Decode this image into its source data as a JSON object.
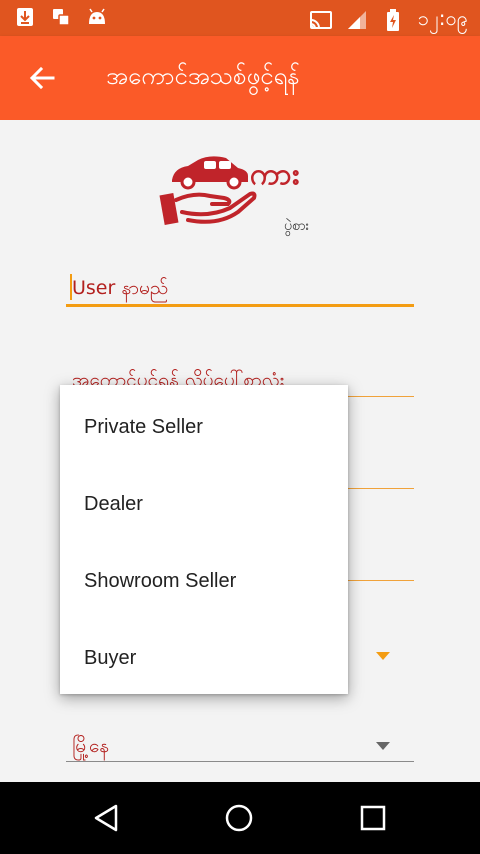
{
  "status_bar": {
    "time": "၁၂:၀၉",
    "left_icons": [
      "download-icon",
      "sim-icon",
      "android-icon"
    ],
    "right_icons": [
      "cast-icon",
      "signal-icon",
      "battery-charging-icon"
    ]
  },
  "app_bar": {
    "title": "အကောင်အသစ်ဖွင့်ရန်",
    "back_icon": "back-arrow-icon"
  },
  "logo": {
    "brand": "ကား",
    "sub": "ပွဲစား"
  },
  "form": {
    "username_label": "User နာမည်",
    "account_type_label": "အကောင့်ပင့်ရန် လိပ်ပေါ်စာလုံး",
    "city_label": "မြို့နေ"
  },
  "dropdown_menu": {
    "options": [
      "Private Seller",
      "Dealer",
      "Showroom Seller",
      "Buyer"
    ]
  },
  "colors": {
    "status_bar": "#e0551f",
    "app_bar": "#fb5a28",
    "accent": "#f39c12",
    "label": "#b3201e",
    "logo_red": "#c0242a"
  },
  "nav_bar": {
    "back_icon": "nav-back-icon",
    "home_icon": "nav-home-icon",
    "recents_icon": "nav-recents-icon"
  }
}
